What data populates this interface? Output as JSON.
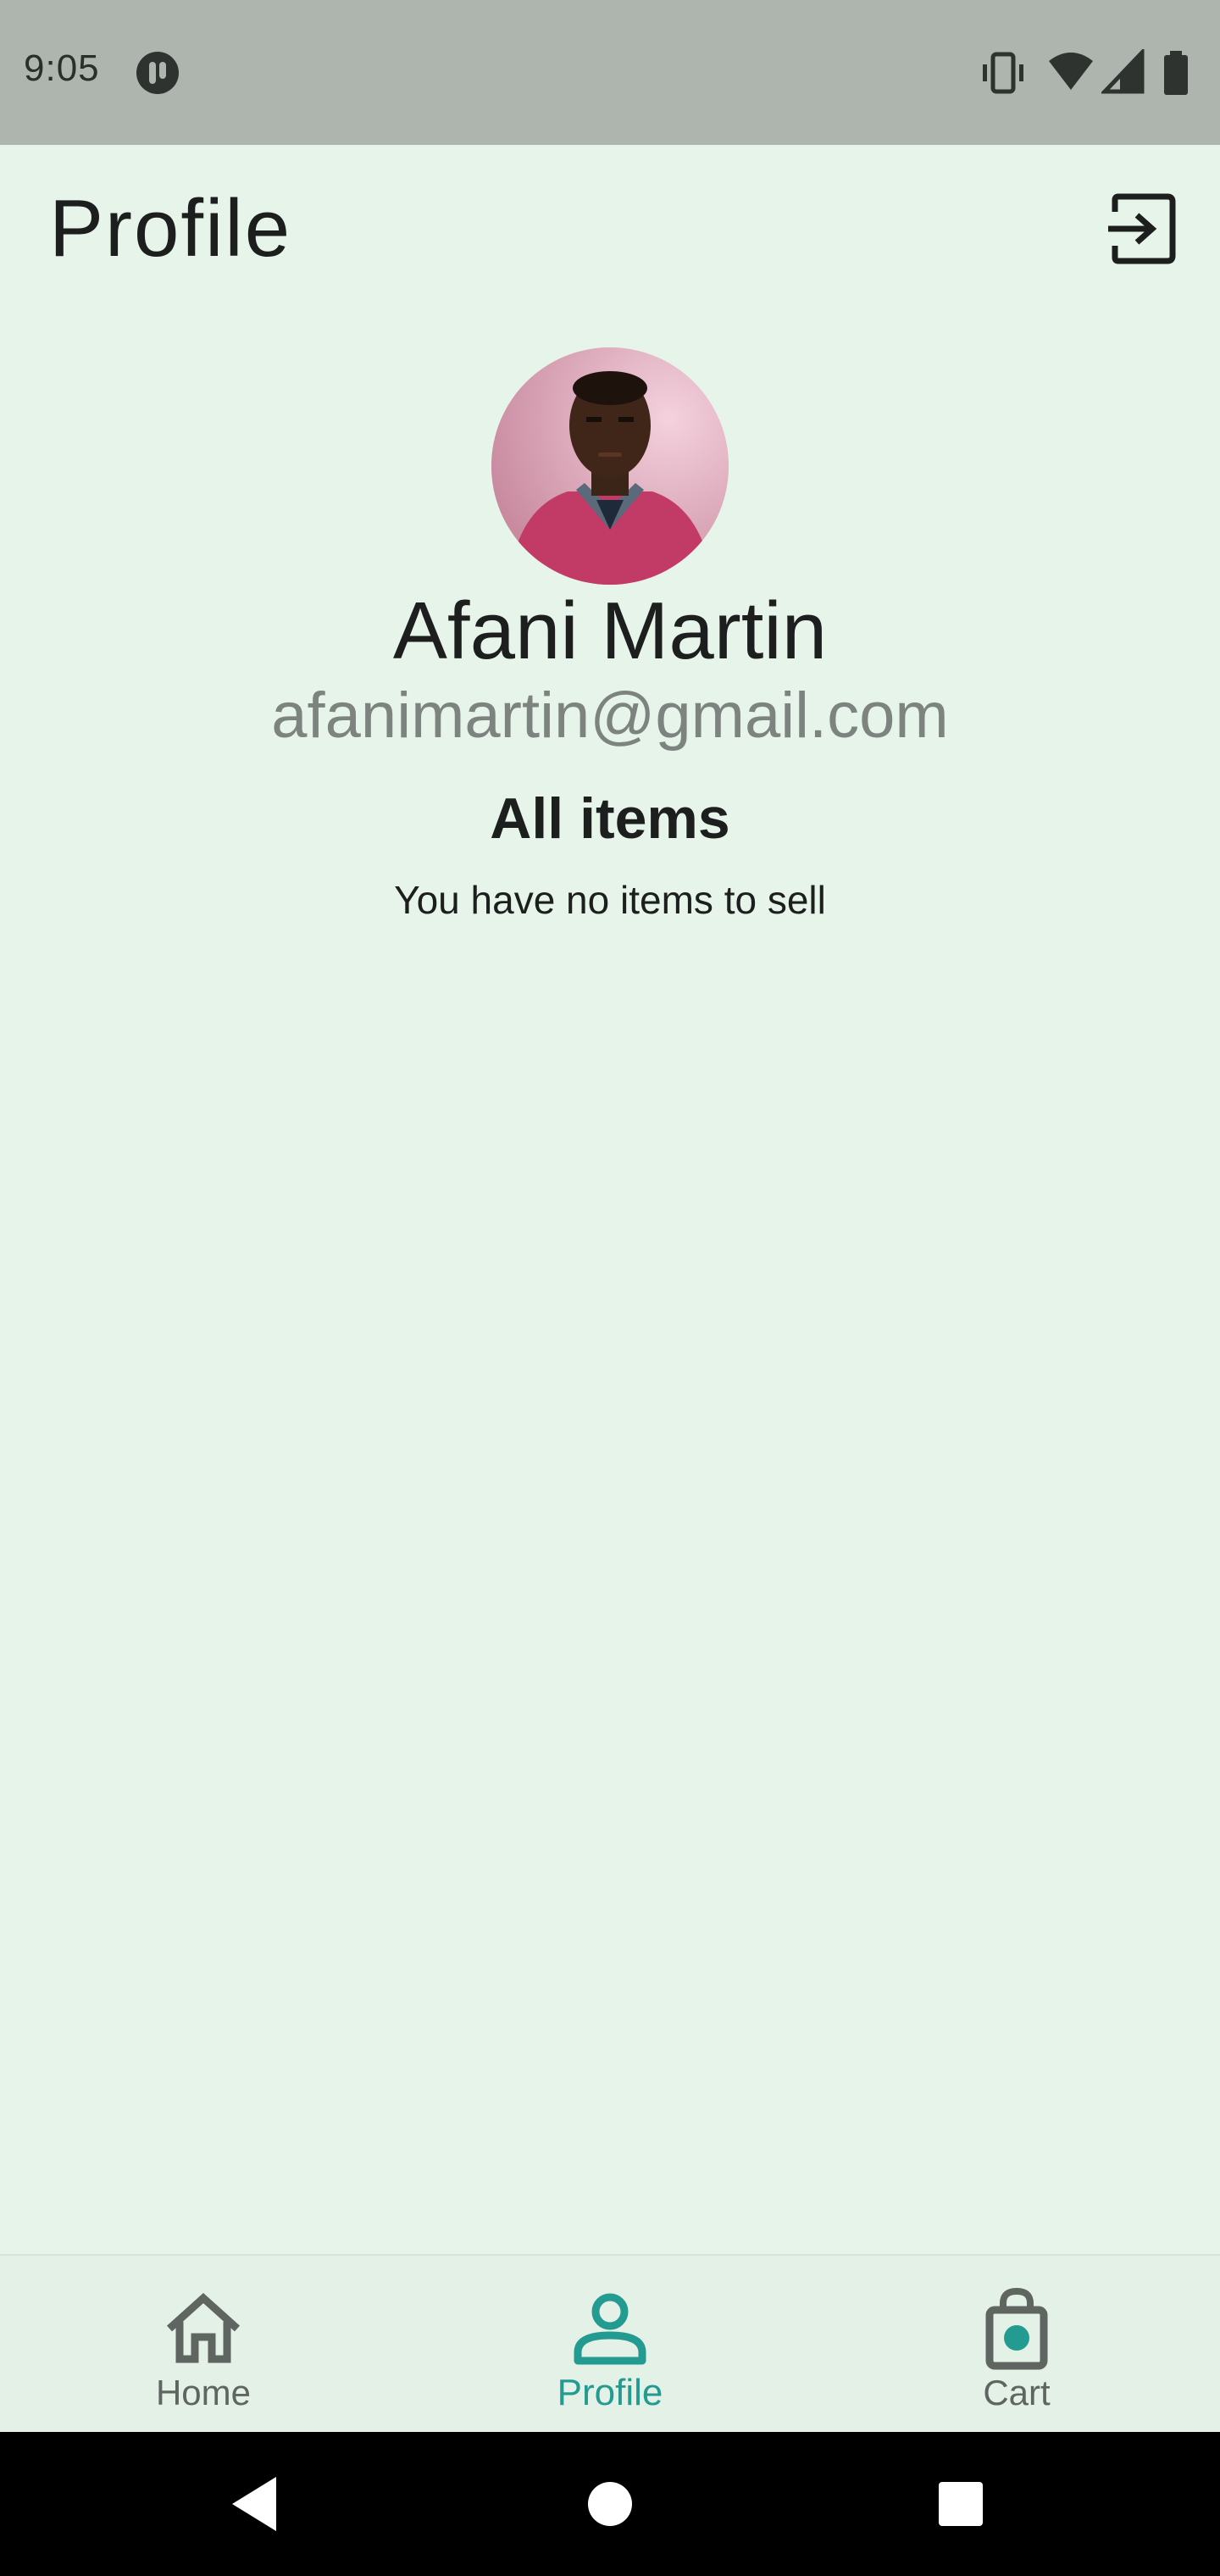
{
  "status_bar": {
    "time": "9:05"
  },
  "header": {
    "title": "Profile",
    "logout_icon": "logout-icon"
  },
  "profile": {
    "name": "Afani Martin",
    "email": "afanimartin@gmail.com",
    "avatar_icon": "user-photo"
  },
  "items_section": {
    "title": "All items",
    "empty_message": "You have no items to sell"
  },
  "bottom_nav": {
    "items": [
      {
        "label": "Home",
        "icon": "home-icon",
        "active": false
      },
      {
        "label": "Profile",
        "icon": "person-icon",
        "active": true
      },
      {
        "label": "Cart",
        "icon": "shopping-bag-icon",
        "active": false
      }
    ]
  },
  "colors": {
    "background": "#e6f4e9",
    "status_bar": "#adb5ae",
    "accent": "#249b90",
    "text_primary": "#1c1f1d",
    "text_secondary": "#7d837f"
  }
}
